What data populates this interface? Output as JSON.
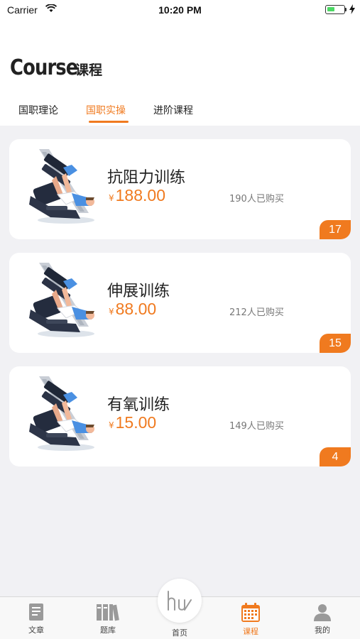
{
  "status_bar": {
    "carrier": "Carrier",
    "time": "10:20 PM"
  },
  "header": {
    "title_en": "Course",
    "title_zh": "课程"
  },
  "tabs": [
    {
      "label": "国职理论",
      "active": false
    },
    {
      "label": "国职实操",
      "active": true
    },
    {
      "label": "进阶课程",
      "active": false
    }
  ],
  "courses": [
    {
      "name": "抗阻力训练",
      "currency": "¥",
      "price": "188.00",
      "buyers": "190人已购买",
      "badge": "17"
    },
    {
      "name": "伸展训练",
      "currency": "¥",
      "price": "88.00",
      "buyers": "212人已购买",
      "badge": "15"
    },
    {
      "name": "有氧训练",
      "currency": "¥",
      "price": "15.00",
      "buyers": "149人已购买",
      "badge": "4"
    }
  ],
  "tabbar": {
    "items": [
      {
        "label": "文章",
        "icon": "document-icon"
      },
      {
        "label": "题库",
        "icon": "books-icon"
      },
      {
        "label": "首页",
        "icon": "hu-logo-icon"
      },
      {
        "label": "课程",
        "icon": "calendar-icon",
        "active": true
      },
      {
        "label": "我的",
        "icon": "person-icon"
      }
    ]
  },
  "colors": {
    "accent": "#f07a1f",
    "background": "#f1f1f4",
    "card": "#ffffff"
  }
}
